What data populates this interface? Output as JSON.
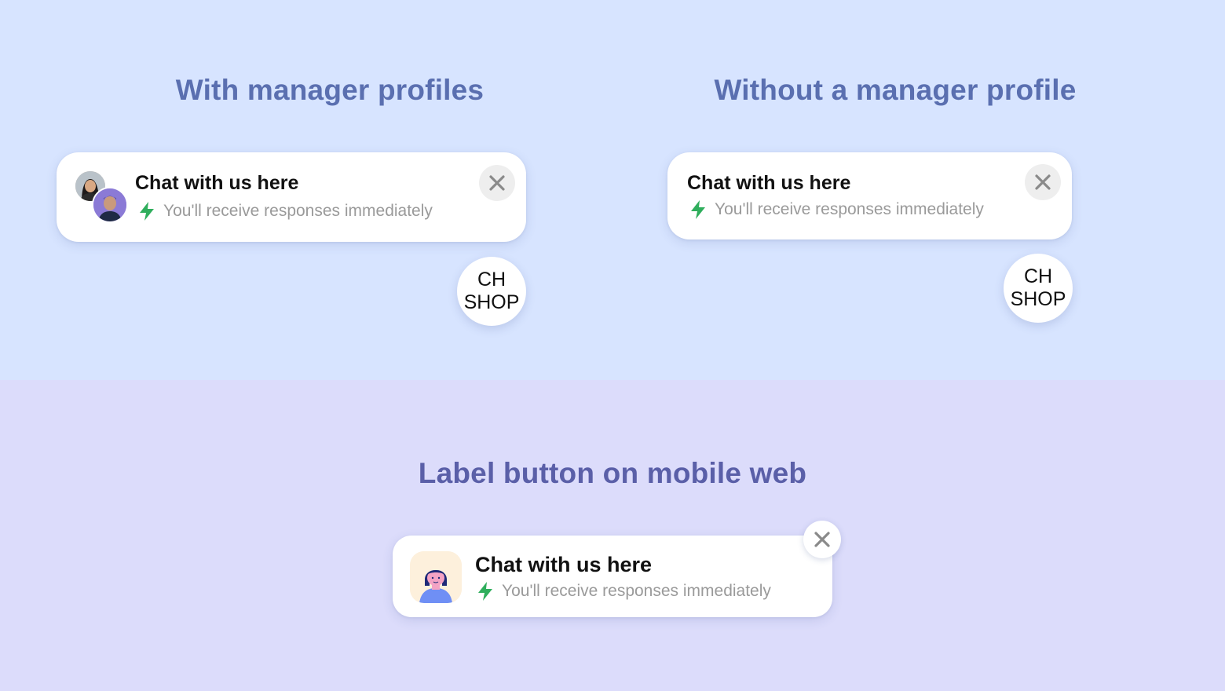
{
  "sections": {
    "with_profiles": {
      "heading": "With manager profiles",
      "card": {
        "title": "Chat with us here",
        "subtitle": "You'll receive responses immediately"
      },
      "shop_button": {
        "line1": "CH",
        "line2": "SHOP"
      }
    },
    "without_profile": {
      "heading": "Without a manager profile",
      "card": {
        "title": "Chat with us here",
        "subtitle": "You'll receive responses immediately"
      },
      "shop_button": {
        "line1": "CH",
        "line2": "SHOP"
      }
    },
    "mobile_web": {
      "heading": "Label button on mobile web",
      "card": {
        "title": "Chat with us here",
        "subtitle": "You'll receive responses immediately"
      }
    }
  },
  "icons": {
    "bolt": "lightning-bolt-icon",
    "close": "close-icon"
  },
  "colors": {
    "top_background": "#d7e4ff",
    "bottom_background": "#dcdcfb",
    "heading": "#5a6fb0",
    "bolt": "#2fae5c",
    "subtitle": "#9a9a9a",
    "close_icon": "#8a8a8a"
  }
}
